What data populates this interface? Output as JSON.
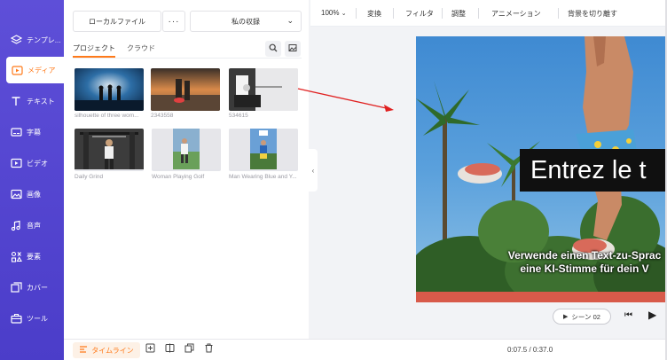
{
  "leftnav": {
    "items": [
      {
        "label": "テンプレ...",
        "icon": "template-icon"
      },
      {
        "label": "メディア",
        "icon": "media-icon",
        "active": true
      },
      {
        "label": "テキスト",
        "icon": "text-icon"
      },
      {
        "label": "字幕",
        "icon": "subtitle-icon"
      },
      {
        "label": "ビデオ",
        "icon": "video-icon"
      },
      {
        "label": "画像",
        "icon": "image-icon"
      },
      {
        "label": "音声",
        "icon": "audio-icon"
      },
      {
        "label": "要素",
        "icon": "elements-icon"
      },
      {
        "label": "カバー",
        "icon": "cover-icon"
      },
      {
        "label": "ツール",
        "icon": "tools-icon"
      }
    ]
  },
  "panel": {
    "local_file_label": "ローカルファイル",
    "more_label": "···",
    "collection_label": "私の収録",
    "tabs": [
      "プロジェクト",
      "クラウド"
    ],
    "media": [
      {
        "caption": "silhouette of three wom..."
      },
      {
        "caption": "2343558"
      },
      {
        "caption": "534615"
      },
      {
        "caption": "Daily Grind"
      },
      {
        "caption": "Woman Playing Golf"
      },
      {
        "caption": "Man Wearing Blue and Y..."
      }
    ]
  },
  "toolbar": {
    "zoom": "100%",
    "items": [
      "変換",
      "フィルタ",
      "調整",
      "アニメーション",
      "背景を切り離す"
    ]
  },
  "canvas": {
    "title_text": "Entrez le t",
    "subtitle_line1": "Verwende einen Text-zu-Sprac",
    "subtitle_line2": "eine KI-Stimme für dein V"
  },
  "player": {
    "scene_label": "シーン 02"
  },
  "bottombar": {
    "timeline_label": "タイムライン",
    "time": "0:07.5 / 0:37.0"
  },
  "colors": {
    "nav": "#5546d4",
    "accent": "#ff7a1a",
    "arrow": "#e02020"
  }
}
